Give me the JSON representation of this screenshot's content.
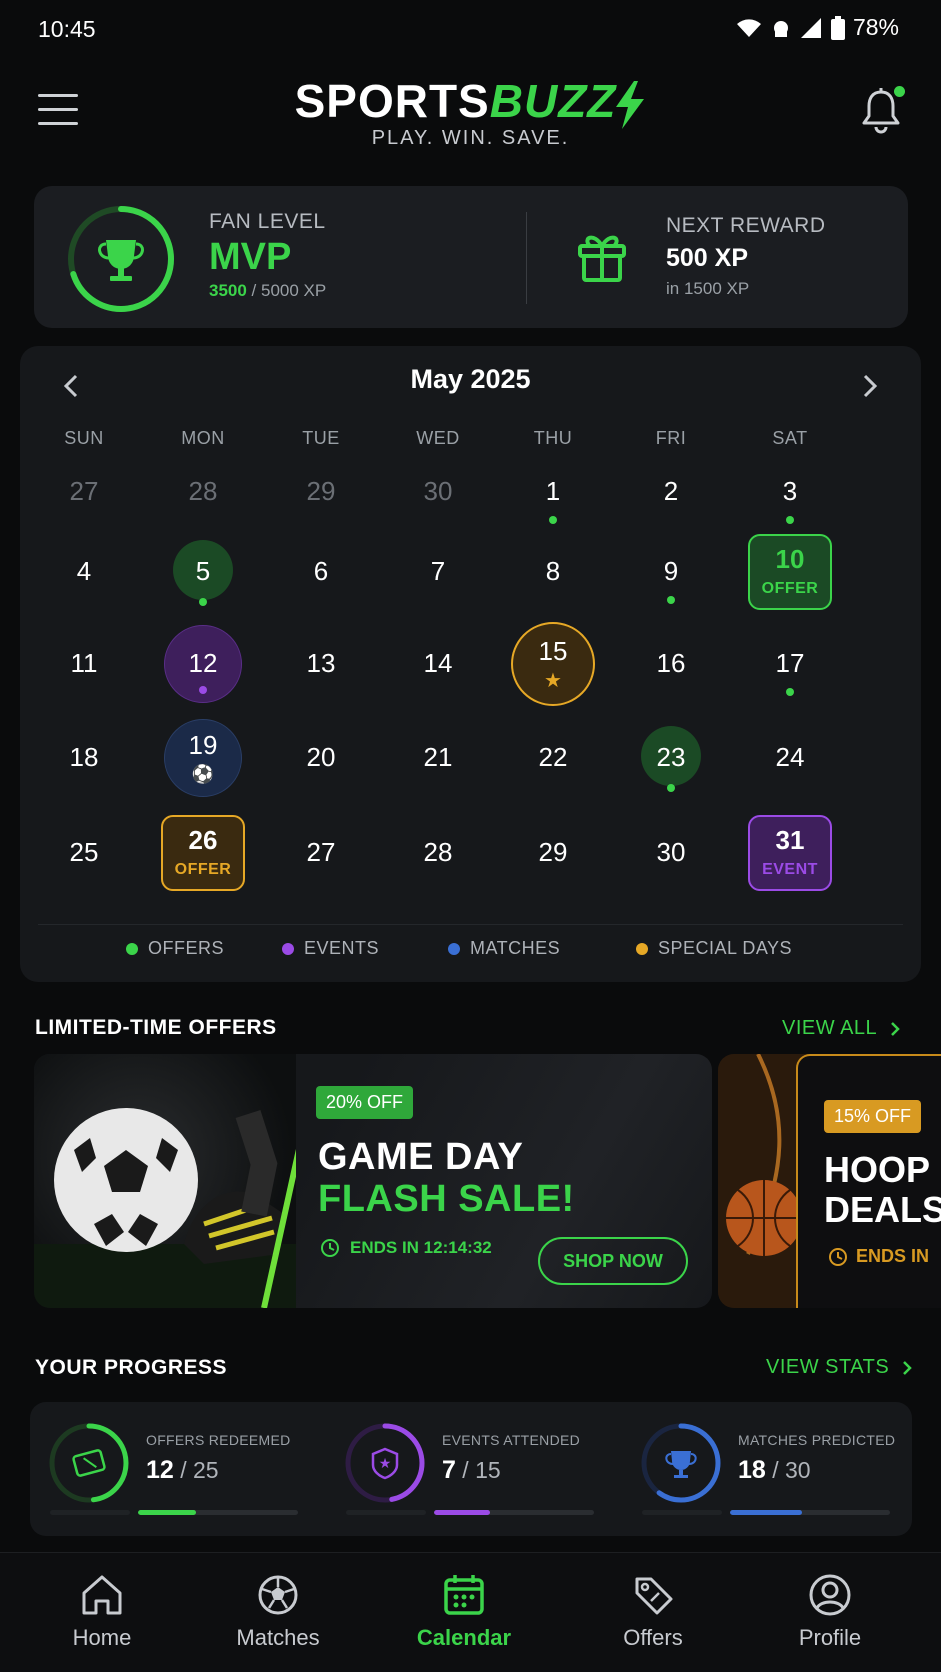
{
  "status": {
    "time": "10:45",
    "battery": "78%"
  },
  "header": {
    "logo_a": "SPORTS",
    "logo_b": "BUZZ",
    "tagline": "PLAY. WIN. SAVE."
  },
  "level": {
    "label": "FAN LEVEL",
    "name": "MVP",
    "xp_current": "3500",
    "xp_total": " / 5000 XP",
    "progress_fraction": 0.7
  },
  "reward": {
    "label": "NEXT REWARD",
    "value": "500 XP",
    "sub": "in 1500 XP"
  },
  "calendar": {
    "title": "May 2025",
    "weekdays": [
      "SUN",
      "MON",
      "TUE",
      "WED",
      "THU",
      "FRI",
      "SAT"
    ],
    "weeks": [
      [
        {
          "d": "27",
          "muted": true
        },
        {
          "d": "28",
          "muted": true
        },
        {
          "d": "29",
          "muted": true
        },
        {
          "d": "30",
          "muted": true
        },
        {
          "d": "1",
          "dot": "offer"
        },
        {
          "d": "2"
        },
        {
          "d": "3",
          "dot": "offer"
        }
      ],
      [
        {
          "d": "4"
        },
        {
          "d": "5",
          "circle": "offer",
          "dot": "offer"
        },
        {
          "d": "6"
        },
        {
          "d": "7"
        },
        {
          "d": "8"
        },
        {
          "d": "9",
          "dot": "offer"
        },
        {
          "d": "10",
          "box": "offer",
          "sub": "OFFER"
        }
      ],
      [
        {
          "d": "11"
        },
        {
          "d": "12",
          "circle": "event",
          "dot": "event"
        },
        {
          "d": "13"
        },
        {
          "d": "14"
        },
        {
          "d": "15",
          "circle": "special",
          "star": true
        },
        {
          "d": "16"
        },
        {
          "d": "17",
          "dot": "offer"
        }
      ],
      [
        {
          "d": "18"
        },
        {
          "d": "19",
          "circle": "match",
          "ball": true
        },
        {
          "d": "20"
        },
        {
          "d": "21"
        },
        {
          "d": "22"
        },
        {
          "d": "23",
          "circle": "offer",
          "dot": "offer"
        },
        {
          "d": "24"
        }
      ],
      [
        {
          "d": "25"
        },
        {
          "d": "26",
          "box": "special",
          "sub": "OFFER"
        },
        {
          "d": "27"
        },
        {
          "d": "28"
        },
        {
          "d": "29"
        },
        {
          "d": "30"
        },
        {
          "d": "31",
          "box": "event",
          "sub": "EVENT"
        }
      ]
    ],
    "legend": [
      {
        "label": "OFFERS",
        "kind": "offer"
      },
      {
        "label": "EVENTS",
        "kind": "event"
      },
      {
        "label": "MATCHES",
        "kind": "match"
      },
      {
        "label": "SPECIAL DAYS",
        "kind": "special"
      }
    ]
  },
  "colors": {
    "offer": "#3bd44a",
    "event": "#9b4be6",
    "match": "#3a6fd4",
    "special": "#e6a826",
    "accent": "#3bd44a"
  },
  "offers_section": {
    "title": "LIMITED-TIME OFFERS",
    "link": "VIEW ALL",
    "card1": {
      "badge": "20% OFF",
      "title1": "GAME DAY",
      "title2": "FLASH SALE!",
      "timer": "ENDS IN 12:14:32",
      "cta": "SHOP NOW"
    },
    "card2": {
      "badge": "15% OFF",
      "title": "HOOP\nDEALS",
      "timer": "ENDS IN"
    }
  },
  "progress_section": {
    "title": "YOUR PROGRESS",
    "link": "VIEW STATS",
    "items": [
      {
        "label": "OFFERS REDEEMED",
        "value": "12",
        "total": " / 25",
        "fraction": 0.48,
        "kind": "offer",
        "icon": "ticket-icon"
      },
      {
        "label": "EVENTS ATTENDED",
        "value": "7",
        "total": " / 15",
        "fraction": 0.47,
        "kind": "event",
        "icon": "shield-star-icon"
      },
      {
        "label": "MATCHES PREDICTED",
        "value": "18",
        "total": " / 30",
        "fraction": 0.6,
        "kind": "match",
        "icon": "trophy-icon"
      }
    ]
  },
  "nav": {
    "items": [
      {
        "label": "Home",
        "icon": "home-icon"
      },
      {
        "label": "Matches",
        "icon": "soccer-ball-icon"
      },
      {
        "label": "Calendar",
        "icon": "calendar-icon",
        "active": true
      },
      {
        "label": "Offers",
        "icon": "tag-icon"
      },
      {
        "label": "Profile",
        "icon": "user-icon"
      }
    ]
  }
}
